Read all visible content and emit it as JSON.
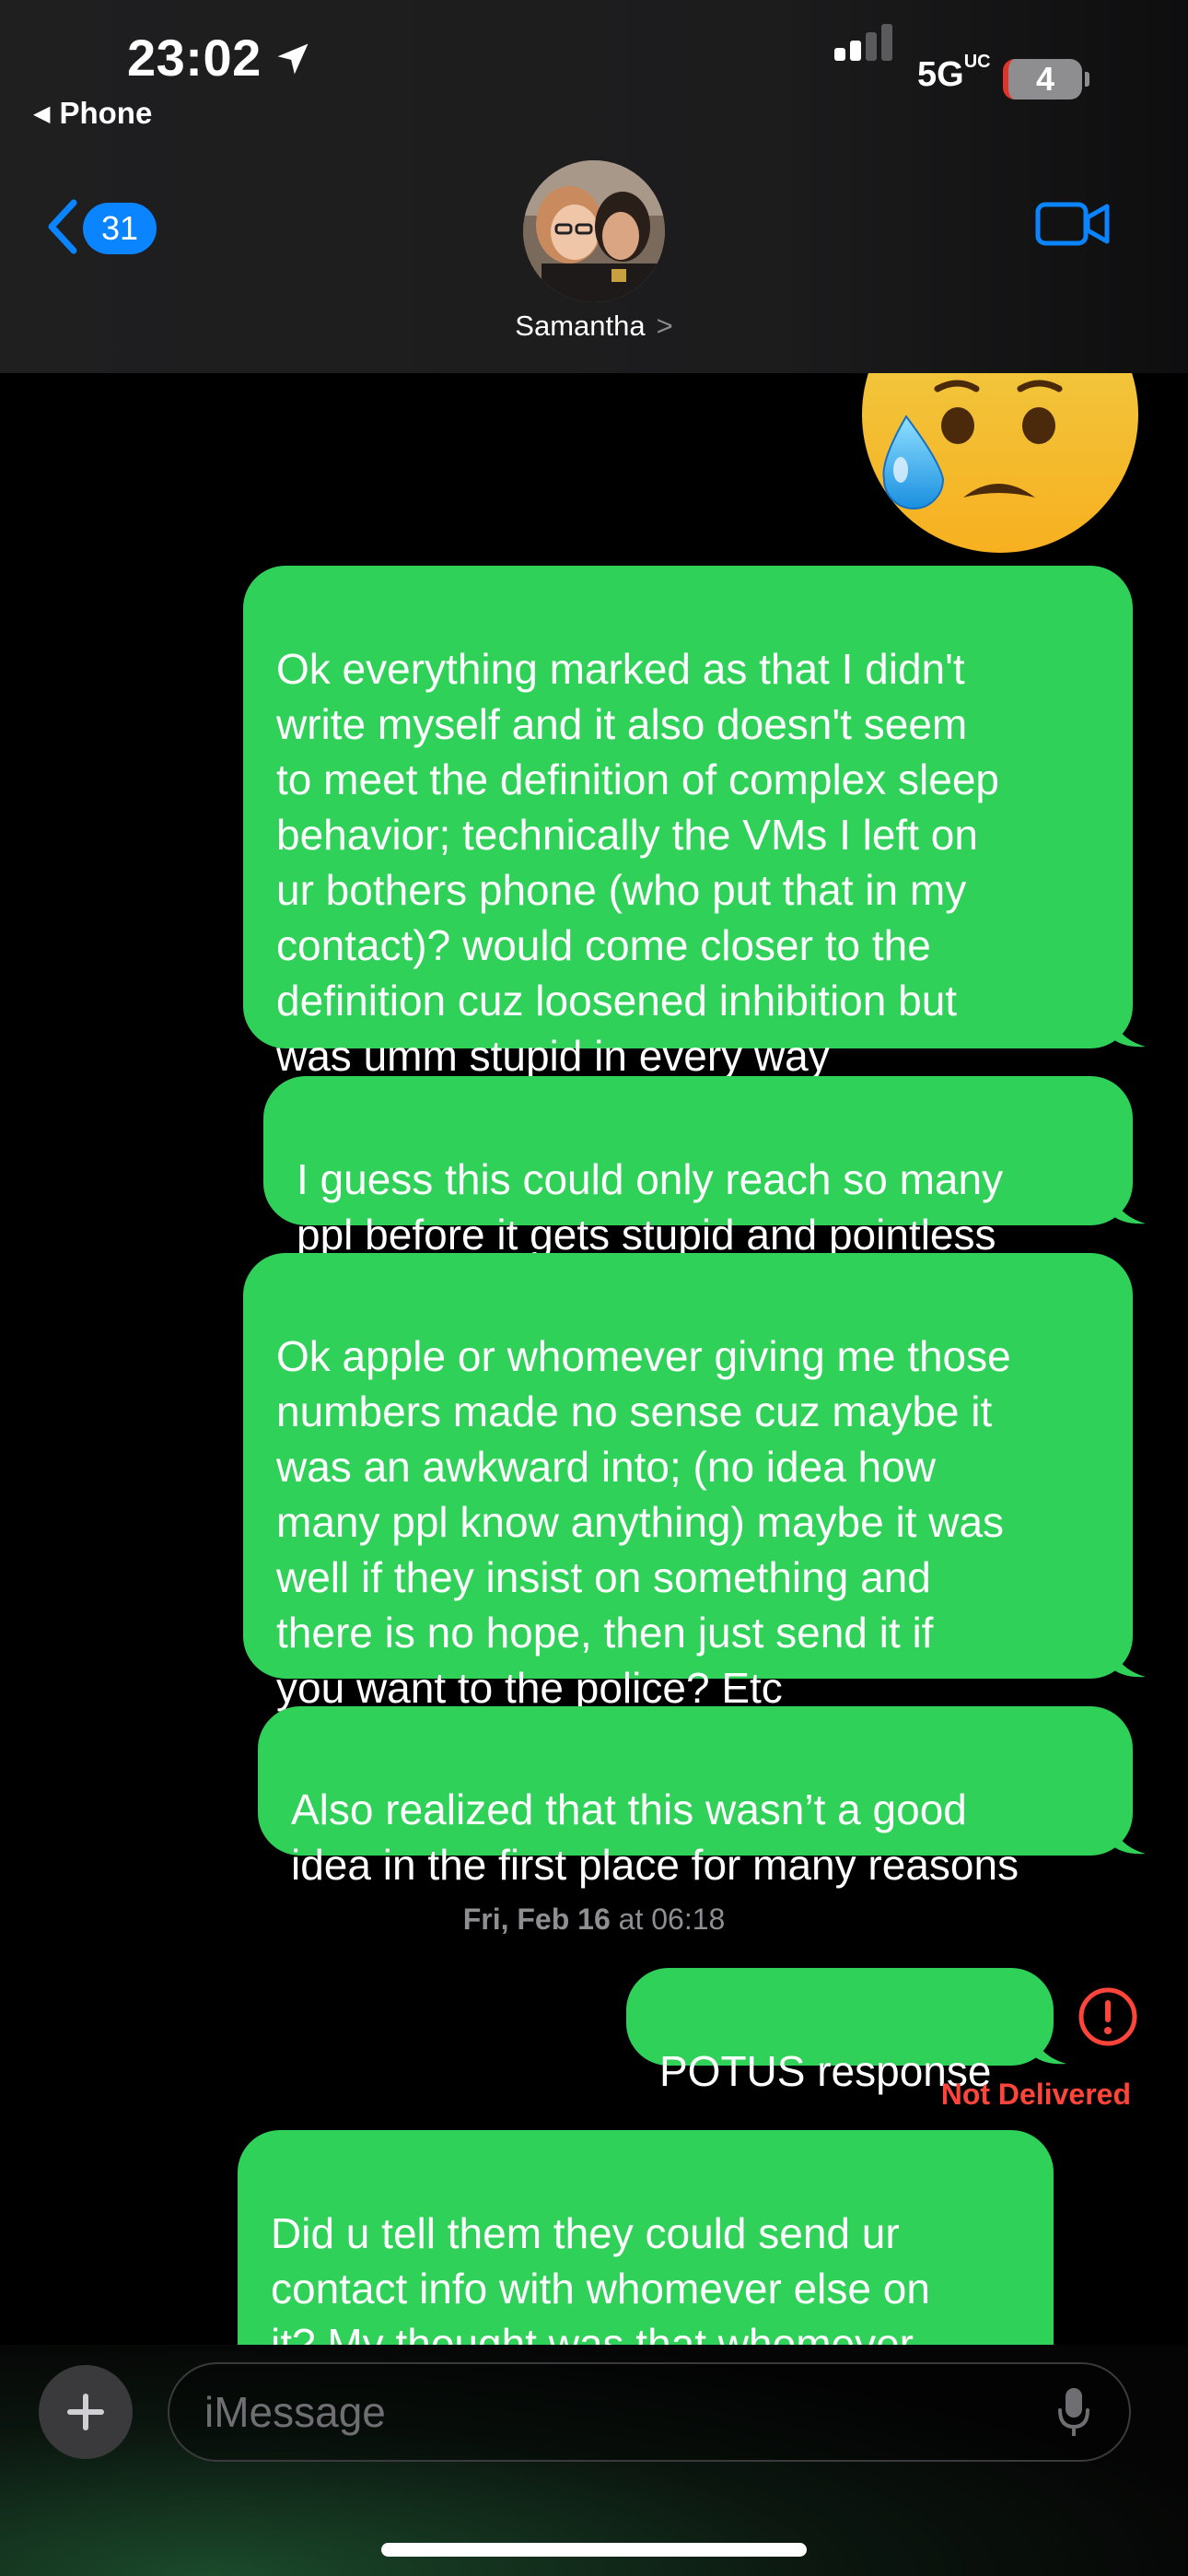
{
  "status_bar": {
    "time": "23:02",
    "back_app": "Phone",
    "network": "5G",
    "network_suffix": "UC",
    "battery": "4"
  },
  "header": {
    "unread_count": "31",
    "contact_name": "Samantha",
    "contact_chevron": ">"
  },
  "messages": [
    {
      "type": "emoji",
      "emoji_name": "anxious-face-with-sweat",
      "sender": "me"
    },
    {
      "type": "text",
      "sender": "me",
      "text": "Ok everything marked as that I didn't\nwrite myself and it also doesn't seem\nto meet the definition of complex sleep\nbehavior; technically the VMs I left on\nur bothers phone (who put that in my\ncontact)? would come closer to the\ndefinition cuz loosened inhibition but\nwas umm stupid in every way"
    },
    {
      "type": "text",
      "sender": "me",
      "text": "I guess this could only reach so many\nppl before it gets stupid and pointless"
    },
    {
      "type": "text",
      "sender": "me",
      "text": "Ok apple or whomever giving me those\nnumbers made no sense cuz maybe it\nwas an awkward into; (no idea how\nmany ppl know anything) maybe it was\nwell if they insist on something and\nthere is no hope, then just send it if\nyou want to the police? Etc"
    },
    {
      "type": "text",
      "sender": "me",
      "text": "Also realized that this wasn’t a good\nidea in the first place for many reasons"
    },
    {
      "type": "text",
      "sender": "me",
      "text": "POTUS response",
      "status": "Not Delivered"
    },
    {
      "type": "text",
      "sender": "me",
      "text": "Did u tell them they could send ur\ncontact info with whomever else on\nit? My thought was that whomever\nwas doing this to me was so illegal"
    }
  ],
  "timestamp": {
    "day": "Fri, Feb 16",
    "at": "at",
    "time": "06:18"
  },
  "input": {
    "placeholder": "iMessage"
  },
  "colors": {
    "sms_bubble": "#30d158",
    "accent_blue": "#0a84ff",
    "error_red": "#ff453a"
  }
}
